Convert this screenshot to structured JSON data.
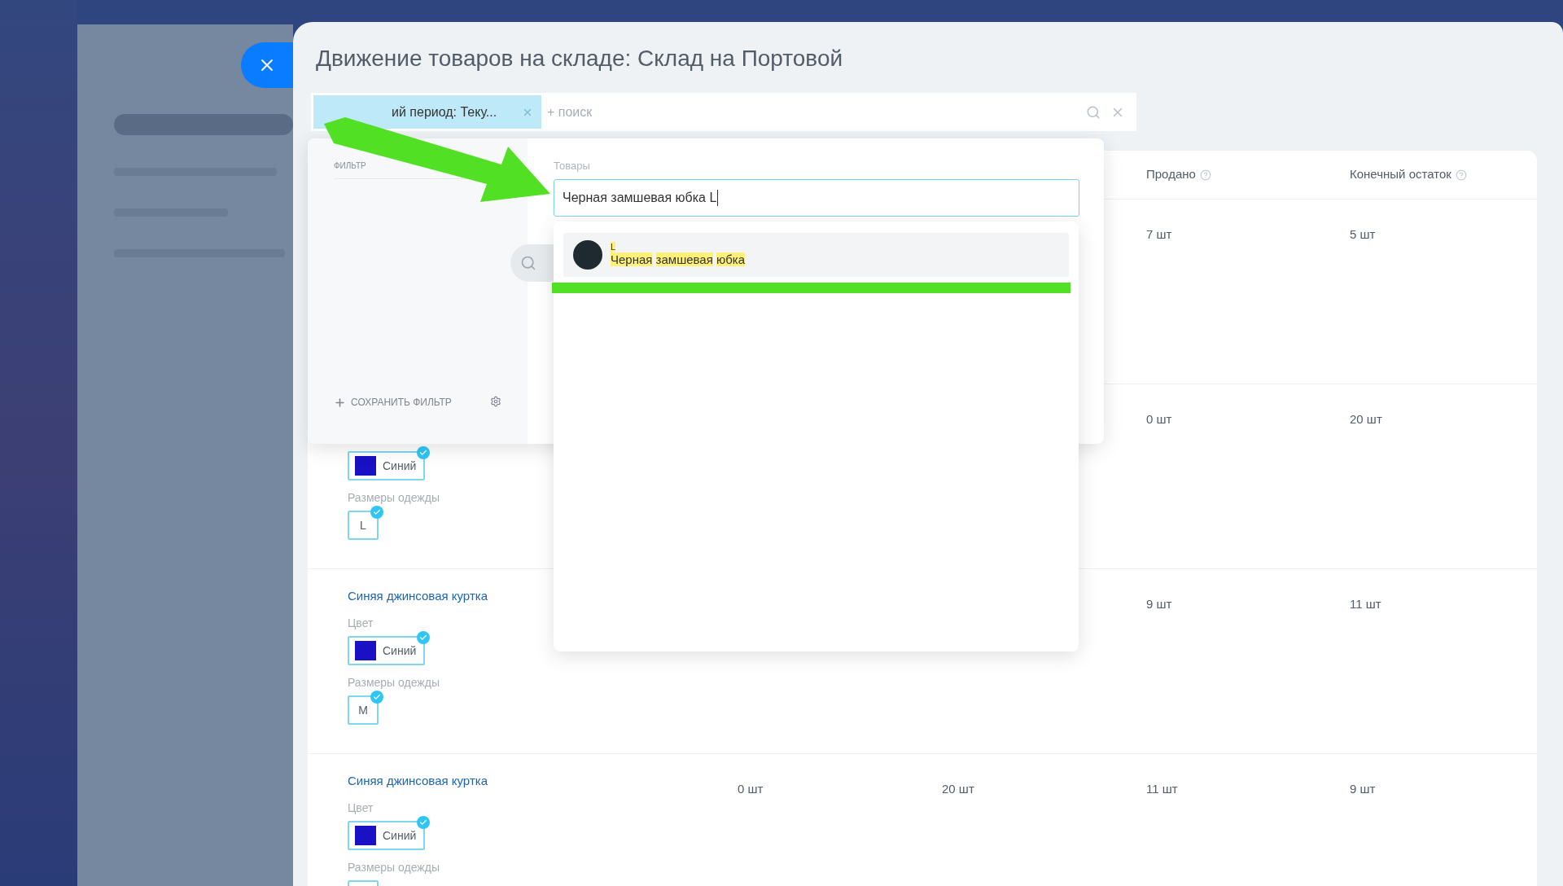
{
  "title": "Движение товаров на складе: Склад на Портовой",
  "filter_bar": {
    "chips": [
      {
        "label": "ий период: Теку..."
      }
    ],
    "placeholder": "+ поиск"
  },
  "filter_popup": {
    "heading": "ФИЛЬТР",
    "save_label": "СОХРАНИТЬ ФИЛЬТР",
    "field": {
      "label": "Товары",
      "value": "Черная замшевая юбка L"
    },
    "suggestions": [
      {
        "caption": "L",
        "name": "Черная замшевая юбка",
        "selected": true
      }
    ]
  },
  "table": {
    "columns": [
      {},
      {},
      {
        "label": "Продано"
      },
      {
        "label": "Конечный остаток"
      }
    ],
    "rows": [
      {
        "cells": [
          null,
          null,
          "7 шт",
          "5 шт"
        ],
        "attributes": []
      },
      {
        "cells": [
          null,
          null,
          "0 шт",
          "20 шт"
        ],
        "attributes": [
          {
            "kind": "color",
            "value": "Синий",
            "color": "#1a10c4",
            "checked": true
          },
          {
            "kind": "size",
            "label": "Размеры одежды",
            "value": "L",
            "checked": true
          }
        ]
      },
      {
        "name": "Синяя джинсовая куртка",
        "cells": [
          null,
          null,
          "9 шт",
          "11 шт"
        ],
        "attributes": [
          {
            "kind": "color",
            "label": "Цвет",
            "value": "Синий",
            "color": "#1a10c4",
            "checked": true
          },
          {
            "kind": "size",
            "label": "Размеры одежды",
            "value": "M",
            "checked": true
          }
        ]
      },
      {
        "name": "Синяя джинсовая куртка",
        "cells": [
          "0 шт",
          "20 шт",
          "11 шт",
          "9 шт"
        ],
        "attributes": [
          {
            "kind": "color",
            "label": "Цвет",
            "value": "Синий",
            "color": "#1a10c4",
            "checked": true
          },
          {
            "kind": "size",
            "label": "Размеры одежды"
          }
        ]
      }
    ]
  }
}
